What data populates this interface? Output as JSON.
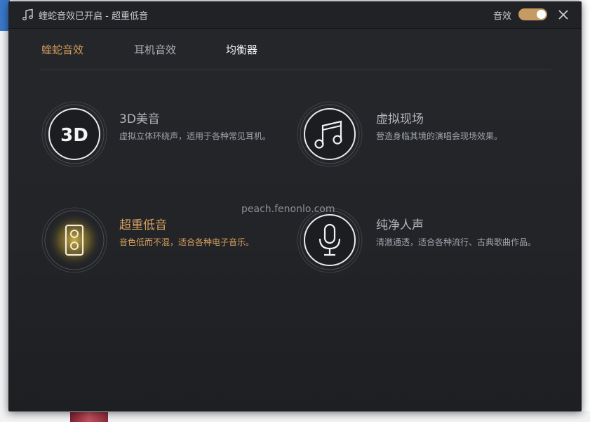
{
  "window": {
    "title": "蝰蛇音效已开启 - 超重低音",
    "switch_label": "音效",
    "switch_on": true
  },
  "tabs": [
    {
      "label": "蝰蛇音效",
      "state": "active"
    },
    {
      "label": "耳机音效",
      "state": "normal"
    },
    {
      "label": "均衡器",
      "state": "normal"
    }
  ],
  "effects": [
    {
      "icon_label": "3D",
      "title": "3D美音",
      "desc": "虚拟立体环绕声，适用于各种常见耳机。",
      "icon": "3d-icon",
      "selected": false
    },
    {
      "title": "虚拟现场",
      "desc": "营造身临其境的演唱会现场效果。",
      "icon": "music-note-icon",
      "selected": false
    },
    {
      "title": "超重低音",
      "desc": "音色低而不混，适合各种电子音乐。",
      "icon": "speaker-icon",
      "selected": true
    },
    {
      "title": "纯净人声",
      "desc": "清澈通透，适合各种流行、古典歌曲作品。",
      "icon": "microphone-icon",
      "selected": false
    }
  ],
  "watermark": "peach.fenonlo.com",
  "colors": {
    "accent": "#d19a5a",
    "switch": "#c59a63",
    "dialog_bg": "#222428"
  }
}
